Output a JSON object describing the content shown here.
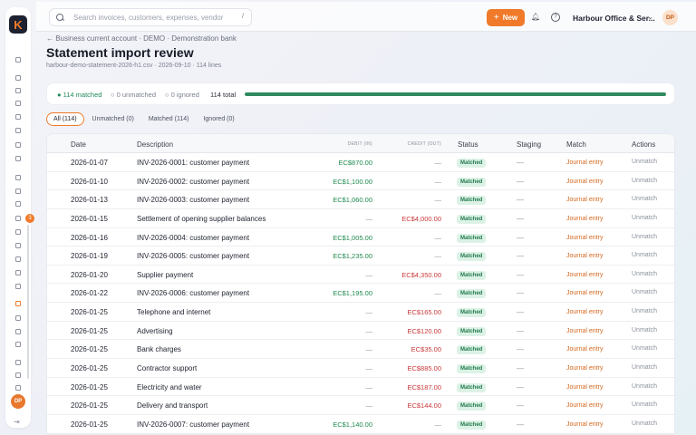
{
  "sidebar": {
    "logo_letter": "K",
    "icons": [
      "home-icon",
      "layers-icon",
      "box-icon",
      "invoice-icon",
      "file-icon",
      "file-icon",
      "receipt-icon",
      "clock-icon",
      "file-icon",
      "bank-icon",
      "copy-icon",
      "file-icon",
      "refresh-icon",
      "cart-icon",
      "file-icon",
      "list-icon",
      "truck-icon",
      "book-icon",
      "book-icon",
      "play-icon",
      "card-icon",
      "grid-icon",
      "refresh-icon",
      "settings-icon"
    ],
    "active_icon_index": 17,
    "badge_count": "3",
    "avatar_initials": "DP"
  },
  "topbar": {
    "search_placeholder": "Search invoices, customers, expenses, vendor",
    "search_shortcut": "/",
    "new_label": "New",
    "org_name": "Harbour Office & Ser...",
    "avatar_initials": "DP"
  },
  "header": {
    "breadcrumb": "← Business current account · DEMO · Demonstration bank",
    "title": "Statement import review",
    "file_meta": "harbour-demo-statement-2026-h1.csv · 2026-09-10 · 114 lines"
  },
  "summary": {
    "matched": "114 matched",
    "unmatched": "0 unmatched",
    "ignored": "0 ignored",
    "total": "114 total",
    "progress_fraction": 1.0,
    "progress_color": "#2f8a5e"
  },
  "filters": [
    {
      "label": "All (114)",
      "active": true
    },
    {
      "label": "Unmatched (0)",
      "active": false
    },
    {
      "label": "Matched (114)",
      "active": false
    },
    {
      "label": "Ignored (0)",
      "active": false
    }
  ],
  "table": {
    "columns": {
      "date": "Date",
      "description": "Description",
      "debit": "DEBIT (IN)",
      "credit": "CREDIT (OUT)",
      "status": "Status",
      "staging": "Staging",
      "match": "Match",
      "actions": "Actions"
    },
    "rows": [
      {
        "date": "2026-01-07",
        "description": "INV-2026-0001: customer payment",
        "debit": "EC$870.00",
        "credit": "—",
        "status": "Matched",
        "staging": "—",
        "match": "Journal entry",
        "action": "Unmatch"
      },
      {
        "date": "2026-01-10",
        "description": "INV-2026-0002: customer payment",
        "debit": "EC$1,100.00",
        "credit": "—",
        "status": "Matched",
        "staging": "—",
        "match": "Journal entry",
        "action": "Unmatch"
      },
      {
        "date": "2026-01-13",
        "description": "INV-2026-0003: customer payment",
        "debit": "EC$1,060.00",
        "credit": "—",
        "status": "Matched",
        "staging": "—",
        "match": "Journal entry",
        "action": "Unmatch"
      },
      {
        "date": "2026-01-15",
        "description": "Settlement of opening supplier balances",
        "debit": "—",
        "credit": "EC$4,000.00",
        "status": "Matched",
        "staging": "—",
        "match": "Journal entry",
        "action": "Unmatch"
      },
      {
        "date": "2026-01-16",
        "description": "INV-2026-0004: customer payment",
        "debit": "EC$1,005.00",
        "credit": "—",
        "status": "Matched",
        "staging": "—",
        "match": "Journal entry",
        "action": "Unmatch"
      },
      {
        "date": "2026-01-19",
        "description": "INV-2026-0005: customer payment",
        "debit": "EC$1,235.00",
        "credit": "—",
        "status": "Matched",
        "staging": "—",
        "match": "Journal entry",
        "action": "Unmatch"
      },
      {
        "date": "2026-01-20",
        "description": "Supplier payment",
        "debit": "—",
        "credit": "EC$4,350.00",
        "status": "Matched",
        "staging": "—",
        "match": "Journal entry",
        "action": "Unmatch"
      },
      {
        "date": "2026-01-22",
        "description": "INV-2026-0006: customer payment",
        "debit": "EC$1,195.00",
        "credit": "—",
        "status": "Matched",
        "staging": "—",
        "match": "Journal entry",
        "action": "Unmatch"
      },
      {
        "date": "2026-01-25",
        "description": "Telephone and internet",
        "debit": "—",
        "credit": "EC$165.00",
        "status": "Matched",
        "staging": "—",
        "match": "Journal entry",
        "action": "Unmatch"
      },
      {
        "date": "2026-01-25",
        "description": "Advertising",
        "debit": "—",
        "credit": "EC$120.00",
        "status": "Matched",
        "staging": "—",
        "match": "Journal entry",
        "action": "Unmatch"
      },
      {
        "date": "2026-01-25",
        "description": "Bank charges",
        "debit": "—",
        "credit": "EC$35.00",
        "status": "Matched",
        "staging": "—",
        "match": "Journal entry",
        "action": "Unmatch"
      },
      {
        "date": "2026-01-25",
        "description": "Contractor support",
        "debit": "—",
        "credit": "EC$885.00",
        "status": "Matched",
        "staging": "—",
        "match": "Journal entry",
        "action": "Unmatch"
      },
      {
        "date": "2026-01-25",
        "description": "Electricity and water",
        "debit": "—",
        "credit": "EC$187.00",
        "status": "Matched",
        "staging": "—",
        "match": "Journal entry",
        "action": "Unmatch"
      },
      {
        "date": "2026-01-25",
        "description": "Delivery and transport",
        "debit": "—",
        "credit": "EC$144.00",
        "status": "Matched",
        "staging": "—",
        "match": "Journal entry",
        "action": "Unmatch"
      },
      {
        "date": "2026-01-25",
        "description": "INV-2026-0007: customer payment",
        "debit": "EC$1,140.00",
        "credit": "—",
        "status": "Matched",
        "staging": "—",
        "match": "Journal entry",
        "action": "Unmatch"
      }
    ]
  },
  "colors": {
    "accent": "#f07a2a",
    "debit": "#1f8a4e",
    "credit": "#c9383a",
    "matched_badge_bg": "#dcf2e6"
  }
}
